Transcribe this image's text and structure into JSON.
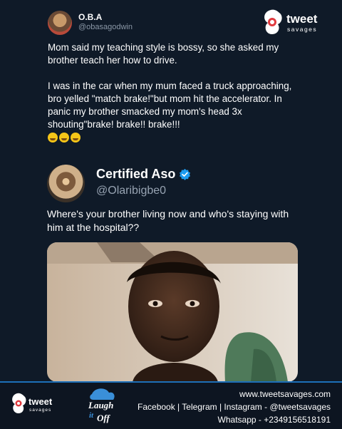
{
  "brand": {
    "name": "tweet",
    "tagline": "savages"
  },
  "tweet1": {
    "display_name": "O.B.A",
    "handle": "@obasagodwin",
    "paragraph1": "Mom said my teaching style is bossy, so she asked my brother teach her how to drive.",
    "paragraph2": "I was in the car when my mum faced a truck approaching, bro yelled \"match brake!\"but mom hit the accelerator. In panic my brother smacked my mom's head 3x shouting\"brake! brake!! brake!!!",
    "emojis": [
      "crying-laughing-emoji",
      "grinning-emoji",
      "grinning-emoji"
    ]
  },
  "tweet2": {
    "display_name": "Certified Aso",
    "handle": "@Olaribigbe0",
    "text": "Where's your brother living now and who's staying with him at the hospital??",
    "verified_color": "#1d9bf0"
  },
  "footer": {
    "website": "www.tweetsavages.com",
    "social": "Facebook | Telegram | Instagram - @tweetsavages",
    "whatsapp": "Whatsapp - +2349156518191",
    "laugh_logo": {
      "line1": "Laugh",
      "line2": "it",
      "line3": "Off"
    }
  },
  "colors": {
    "background": "#0f1a28",
    "accent_blue": "#1d6fb8",
    "brand_red": "#e03a3e"
  }
}
